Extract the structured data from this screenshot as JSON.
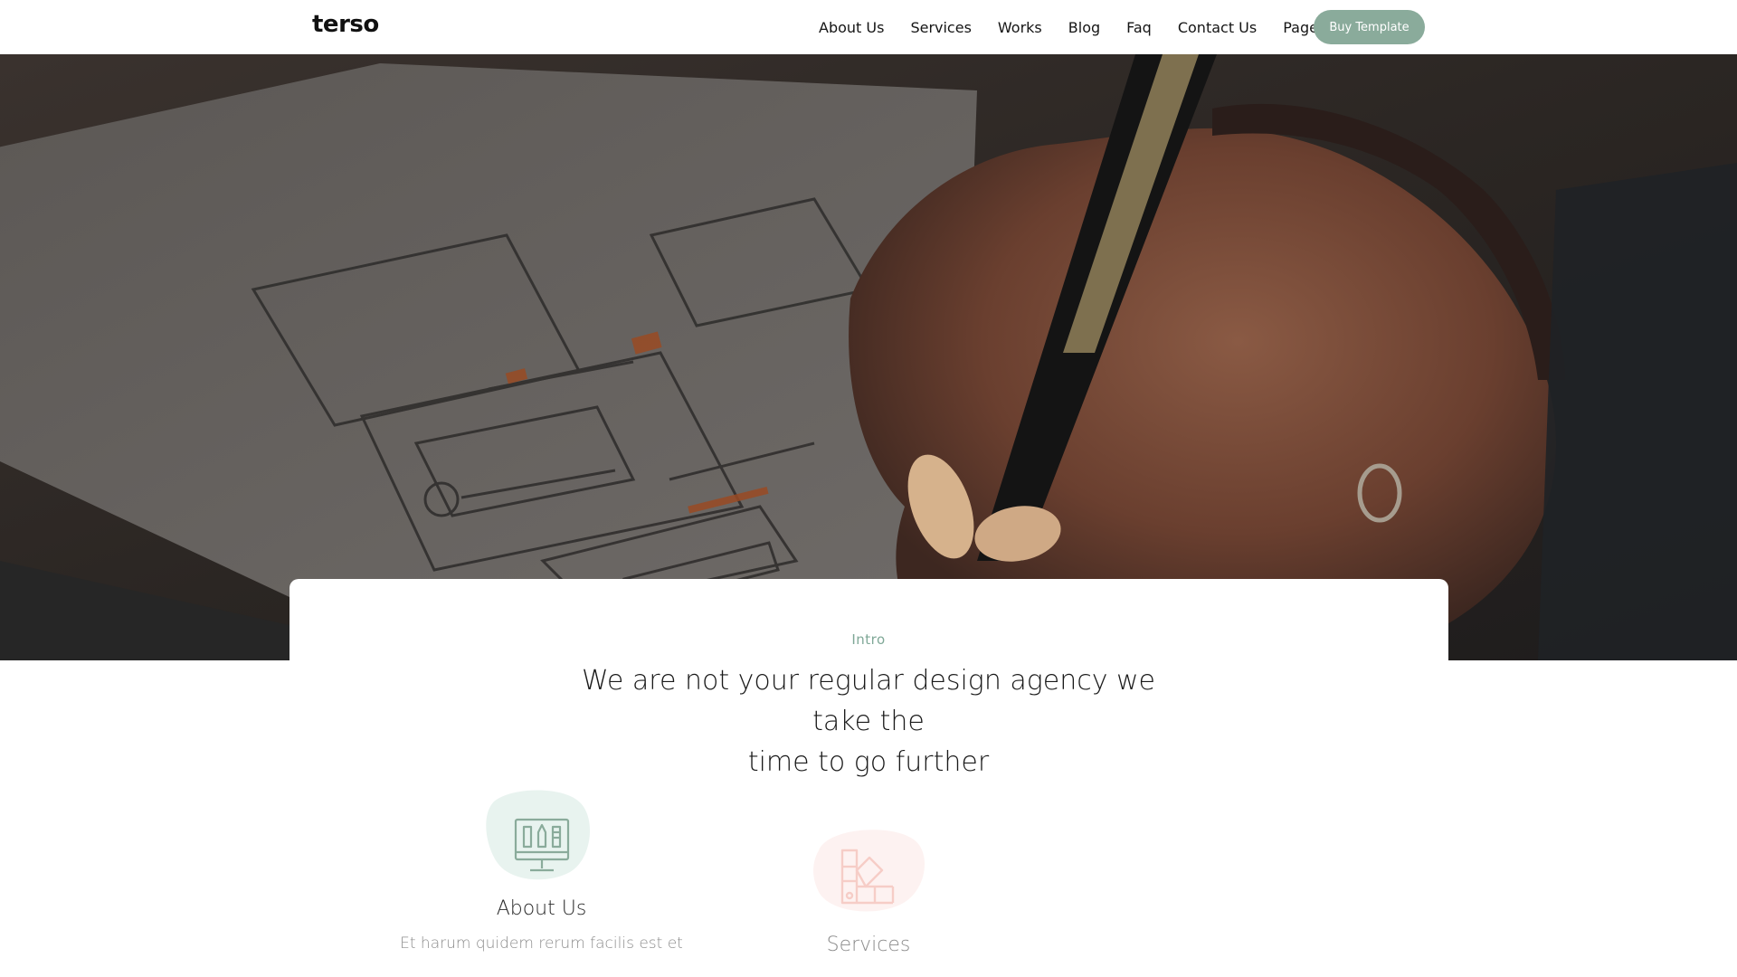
{
  "nav": {
    "brand": "terso",
    "links": [
      "About Us",
      "Services",
      "Works",
      "Blog",
      "Faq",
      "Contact Us"
    ],
    "pages_label": "Pages",
    "pages_icon": "chevron-right-icon",
    "cta_label": "Buy Template"
  },
  "hero": {
    "image_description_icon": "hero-photo"
  },
  "intro": {
    "eyebrow": "Intro",
    "headline_line1": "We are not your regular design agency we take the",
    "headline_line2": "time to go further"
  },
  "features": [
    {
      "title": "About Us",
      "text": "Et harum quidem rerum facilis est et",
      "icon": "monitor-design-icon"
    },
    {
      "title": "Services",
      "icon": "color-swatch-icon"
    }
  ],
  "colors": {
    "accent": "#8aab9b",
    "eyebrow": "#7fa897",
    "blob_green": "#e8f3ef",
    "blob_pink": "#fde9e6",
    "icon_green": "#8aab9b",
    "icon_pink": "#f0a69a"
  }
}
